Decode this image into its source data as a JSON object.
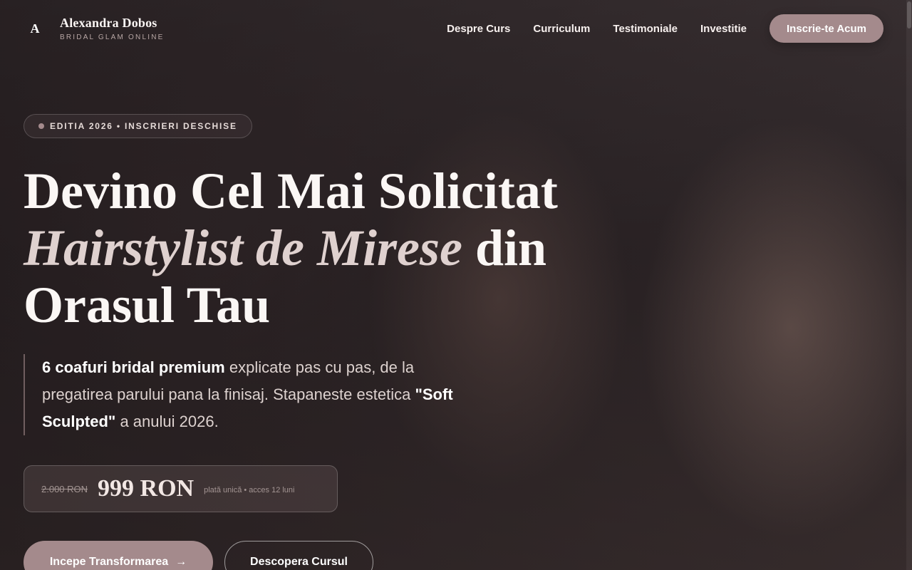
{
  "header": {
    "brand_mark": "A",
    "brand_name": "Alexandra Dobos",
    "brand_tagline": "BRIDAL GLAM ONLINE",
    "nav": [
      "Despre Curs",
      "Curriculum",
      "Testimoniale",
      "Investitie"
    ],
    "cta": "Inscrie-te Acum"
  },
  "hero": {
    "badge": "EDITIA 2026 • INSCRIERI DESCHISE",
    "headline_part1": "Devino Cel Mai Solicitat ",
    "headline_accent": "Hairstylist de Mirese",
    "headline_part2": " din Orasul Tau",
    "lead_bold1": "6 coafuri bridal premium",
    "lead_text1": " explicate pas cu pas, de la pregatirea parului pana la finisaj. Stapaneste estetica ",
    "lead_bold2": "\"Soft Sculpted\"",
    "lead_text2": " a anului 2026.",
    "old_price": "2.000 RON",
    "new_price": "999 RON",
    "price_note": "plată unică • acces 12 luni",
    "primary_button": "Incepe Transformarea",
    "primary_arrow": "→",
    "secondary_button": "Descopera Cursul"
  },
  "colors": {
    "accent": "#a48a8c",
    "background": "#2a2224",
    "text": "#fbf7f5"
  }
}
